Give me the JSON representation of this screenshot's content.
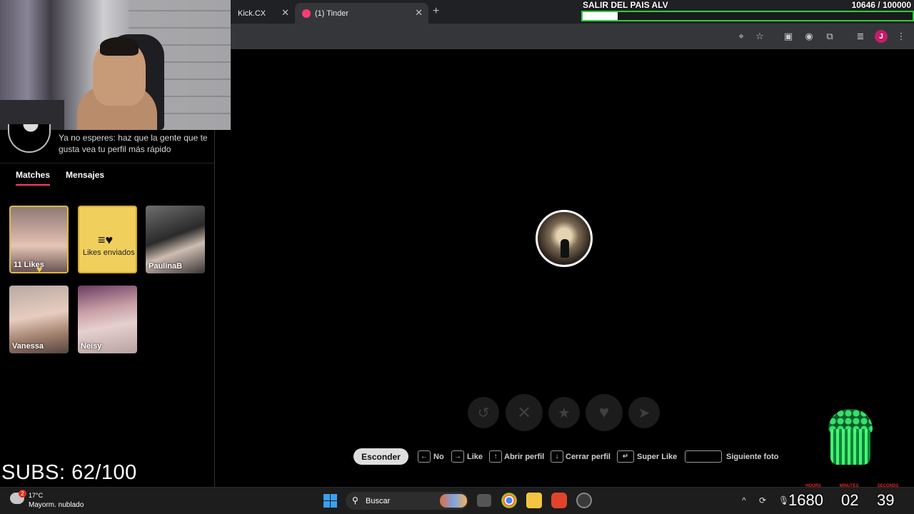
{
  "browser": {
    "tabs": [
      {
        "title": "Kick.CX"
      },
      {
        "title": "(1) Tinder"
      }
    ],
    "profile_initial": "J"
  },
  "goal": {
    "title": "SALIR DEL PAIS ALV",
    "count": "10646  / 100000",
    "progress": 0.10646,
    "bar_color": "#2ecc40"
  },
  "sidebar": {
    "boost_text": "Ya no esperes: haz que la gente que te gusta vea tu perfil más rápido",
    "tabs": {
      "matches": "Matches",
      "messages": "Mensajes"
    },
    "cards": {
      "likes": "11 Likes",
      "sent": "Likes enviados",
      "match1": "PaulinaB",
      "match2": "Vanessa",
      "match3": "Neisy"
    }
  },
  "actions": {
    "icons": [
      "rewind-icon",
      "nope-icon",
      "super-like-icon",
      "like-icon",
      "boost-icon"
    ]
  },
  "shortcuts": {
    "hide": "Esconder",
    "no": "No",
    "like": "Like",
    "open_profile": "Abrir perfil",
    "close_profile": "Cerrar perfil",
    "super_like": "Super Like",
    "next_photo": "Siguiente foto"
  },
  "overlay": {
    "subs": "SUBS: 62/100",
    "timer_labels": [
      "HOURS",
      "MINUTES",
      "SECONDS"
    ],
    "timer_hours": "1680",
    "timer_minutes": "02",
    "timer_seconds": "39"
  },
  "taskbar": {
    "weather_badge": "2",
    "temperature": "17°C",
    "weather": "Mayorm. nublado",
    "search": "Buscar"
  },
  "colors": {
    "tinder_accent": "#fe3c72",
    "gold": "#f1cf5d"
  }
}
